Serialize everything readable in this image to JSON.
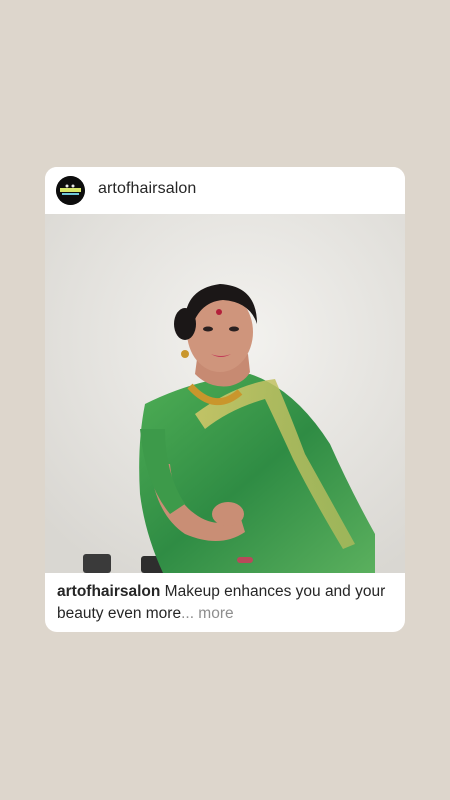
{
  "post": {
    "username": "artofhairsalon",
    "avatar_icon": "salon-logo-icon",
    "image_icon": "post-photo",
    "caption": {
      "user": "artofhairsalon",
      "text": " Makeup enhances you and your beauty even more",
      "ellipsis": "...",
      "more": " more"
    }
  },
  "colors": {
    "background": "#ddd6cc",
    "card": "#ffffff",
    "text": "#262626",
    "muted": "#8e8e8e",
    "saree_green": "#3f9a4a",
    "saree_gold": "#c8b45a"
  }
}
